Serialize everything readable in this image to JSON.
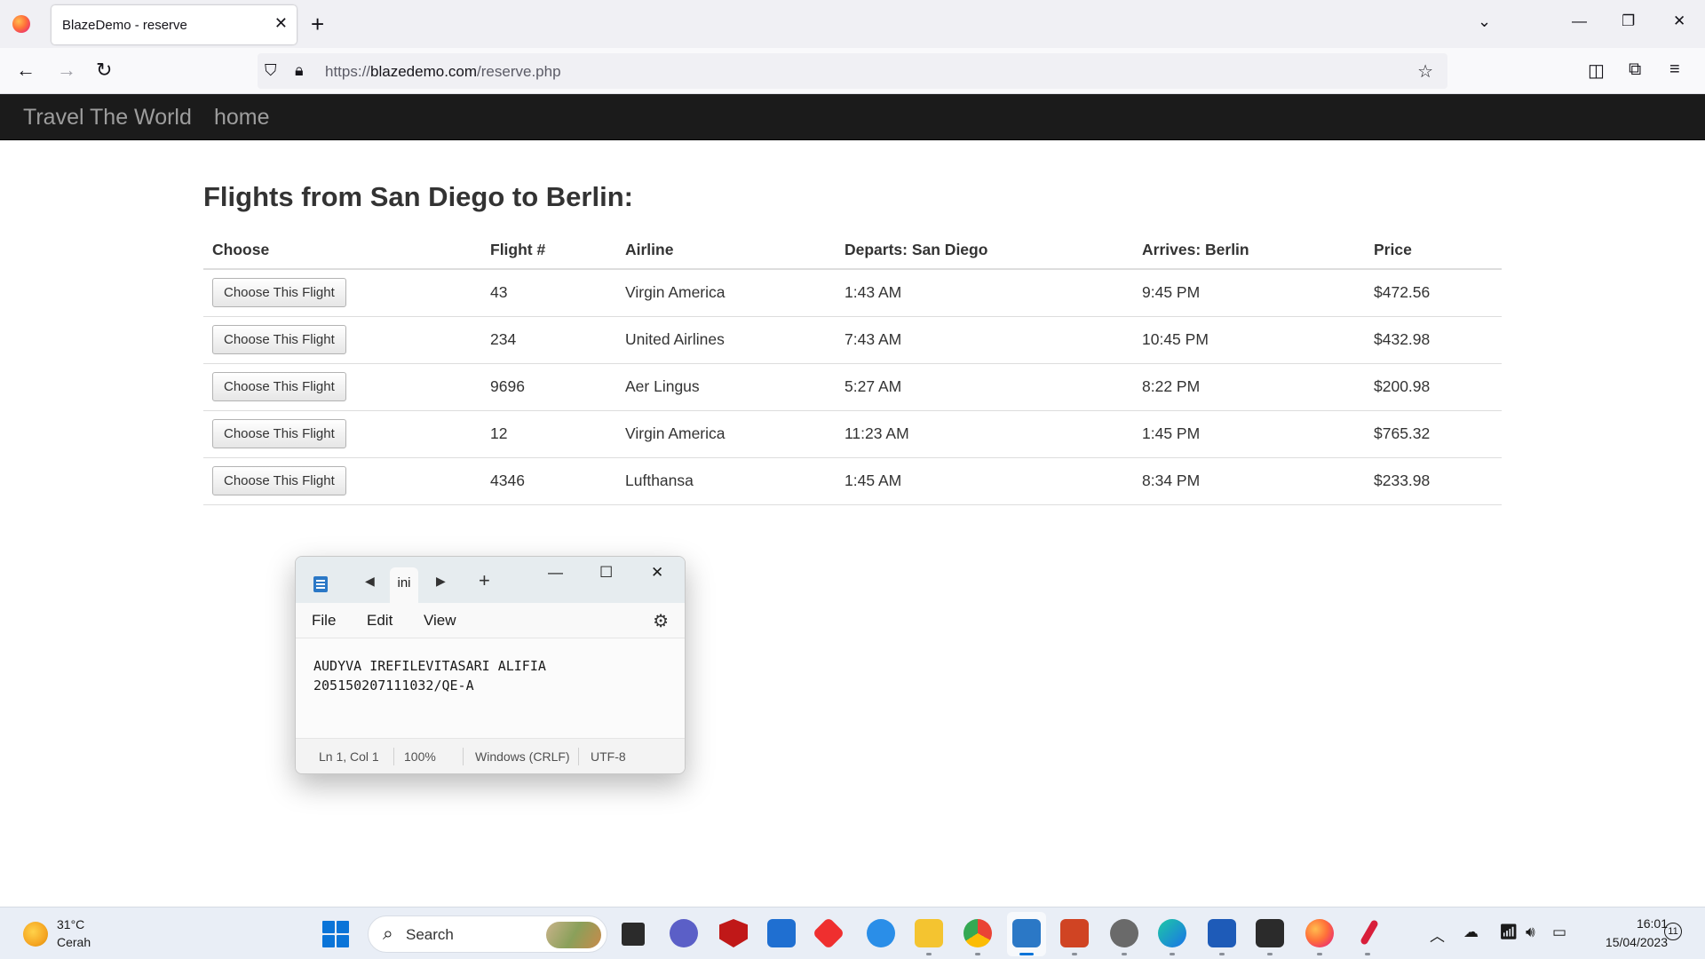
{
  "browser": {
    "tab_title": "BlazeDemo - reserve",
    "url_prefix": "https://",
    "url_host": "blazedemo.com",
    "url_path": "/reserve.php"
  },
  "site": {
    "brand": "Travel The World",
    "home_link": "home"
  },
  "page": {
    "heading": "Flights from San Diego to Berlin:",
    "columns": [
      "Choose",
      "Flight #",
      "Airline",
      "Departs: San Diego",
      "Arrives: Berlin",
      "Price"
    ],
    "rows": [
      {
        "button": "Choose This Flight",
        "flight": "43",
        "airline": "Virgin America",
        "departs": "1:43 AM",
        "arrives": "9:45 PM",
        "price": "$472.56"
      },
      {
        "button": "Choose This Flight",
        "flight": "234",
        "airline": "United Airlines",
        "departs": "7:43 AM",
        "arrives": "10:45 PM",
        "price": "$432.98"
      },
      {
        "button": "Choose This Flight",
        "flight": "9696",
        "airline": "Aer Lingus",
        "departs": "5:27 AM",
        "arrives": "8:22 PM",
        "price": "$200.98"
      },
      {
        "button": "Choose This Flight",
        "flight": "12",
        "airline": "Virgin America",
        "departs": "11:23 AM",
        "arrives": "1:45 PM",
        "price": "$765.32"
      },
      {
        "button": "Choose This Flight",
        "flight": "4346",
        "airline": "Lufthansa",
        "departs": "1:45 AM",
        "arrives": "8:34 PM",
        "price": "$233.98"
      }
    ]
  },
  "notepad": {
    "tab_label": "ini",
    "menu": [
      "File",
      "Edit",
      "View"
    ],
    "lines": [
      "AUDYVA IREFILEVITASARI ALIFIA",
      "205150207111032/QE-A"
    ],
    "status": {
      "position": "Ln 1, Col 1",
      "zoom": "100%",
      "line_ending": "Windows (CRLF)",
      "encoding": "UTF-8"
    }
  },
  "taskbar": {
    "weather_temp": "31°C",
    "weather_condition": "Cerah",
    "search_label": "Search",
    "time": "16:01",
    "date": "15/04/2023",
    "notification_count": "11",
    "apps": [
      "task-view",
      "teams-chat",
      "mcafee",
      "microsoft-store",
      "anydesk",
      "help",
      "file-explorer",
      "chrome",
      "notepad",
      "powerpoint",
      "snipping-tool",
      "edge",
      "word",
      "terminal",
      "firefox",
      "pen-app"
    ]
  },
  "colors": {
    "site_nav_bg": "#1b1b1b",
    "site_nav_text": "#9d9d9d",
    "accent": "#0a74d8"
  }
}
